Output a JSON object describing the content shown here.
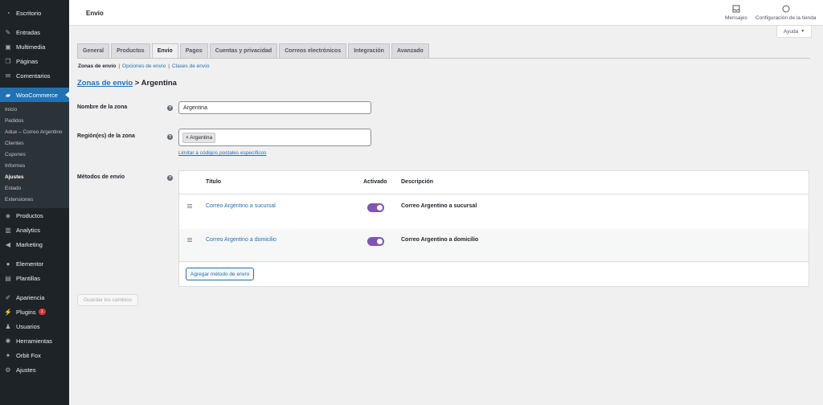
{
  "colors": {
    "accent": "#2271b1",
    "sidebar_bg": "#1d2327",
    "toggle_on": "#7f54b3"
  },
  "sidebar": {
    "top_items": [
      {
        "label": "Escritorio",
        "icon": "dashboard-icon"
      },
      {
        "label": "Entradas",
        "icon": "pushpin-icon"
      },
      {
        "label": "Multimedia",
        "icon": "media-icon"
      },
      {
        "label": "Páginas",
        "icon": "pages-icon"
      },
      {
        "label": "Comentarios",
        "icon": "comments-icon"
      }
    ],
    "woo": {
      "label": "WooCommerce",
      "icon": "woocommerce-icon"
    },
    "woo_sub": [
      {
        "label": "Inicio"
      },
      {
        "label": "Pedidos"
      },
      {
        "label": "Adue – Correo Argentino"
      },
      {
        "label": "Clientes"
      },
      {
        "label": "Cupones"
      },
      {
        "label": "Informes"
      },
      {
        "label": "Ajustes",
        "current": true
      },
      {
        "label": "Estado"
      },
      {
        "label": "Extensiones"
      }
    ],
    "mid_items": [
      {
        "label": "Productos",
        "icon": "products-icon"
      },
      {
        "label": "Analytics",
        "icon": "analytics-icon"
      },
      {
        "label": "Marketing",
        "icon": "megaphone-icon"
      }
    ],
    "mid2_items": [
      {
        "label": "Elementor",
        "icon": "elementor-icon"
      },
      {
        "label": "Plantillas",
        "icon": "templates-icon"
      }
    ],
    "bottom_items": [
      {
        "label": "Apariencia",
        "icon": "brush-icon"
      },
      {
        "label": "Plugins",
        "icon": "plugin-icon",
        "badge": "1"
      },
      {
        "label": "Usuarios",
        "icon": "users-icon"
      },
      {
        "label": "Herramientas",
        "icon": "wrench-icon"
      },
      {
        "label": "Orbit Fox",
        "icon": "fox-icon"
      },
      {
        "label": "Ajustes",
        "icon": "settings-icon"
      }
    ]
  },
  "header": {
    "title": "Envío",
    "messages_label": "Mensajes",
    "store_setup_label": "Configuración de la tienda",
    "help_label": "Ayuda"
  },
  "tabs": [
    {
      "label": "General"
    },
    {
      "label": "Productos"
    },
    {
      "label": "Envío",
      "active": true
    },
    {
      "label": "Pagos"
    },
    {
      "label": "Cuentas y privacidad"
    },
    {
      "label": "Correos electrónicos"
    },
    {
      "label": "Integración"
    },
    {
      "label": "Avanzado"
    }
  ],
  "subtabs": {
    "zones": "Zonas de envío",
    "options": "Opciones de envío",
    "classes": "Clases de envío",
    "separator": "|"
  },
  "breadcrumb": {
    "link": "Zonas de envío",
    "current": "> Argentina"
  },
  "form": {
    "zone_name_label": "Nombre de la zona",
    "zone_name_value": "Argentina",
    "regions_label": "Región(es) de la zona",
    "region_chip": "× Argentina",
    "postcode_link": "Limitar a códigos postales específicos",
    "methods_label": "Métodos de envío",
    "help_mark": "?"
  },
  "methods_table": {
    "col_title": "Título",
    "col_enabled": "Activado",
    "col_description": "Descripción",
    "rows": [
      {
        "title": "Correo Argentino a sucursal",
        "enabled": true,
        "description": "Correo Argentino a sucursal"
      },
      {
        "title": "Correo Argentino a domicilio",
        "enabled": true,
        "description": "Correo Argentino a domicilio"
      }
    ],
    "add_button": "Agregar método de envío"
  },
  "save_button": "Guardar los cambios"
}
